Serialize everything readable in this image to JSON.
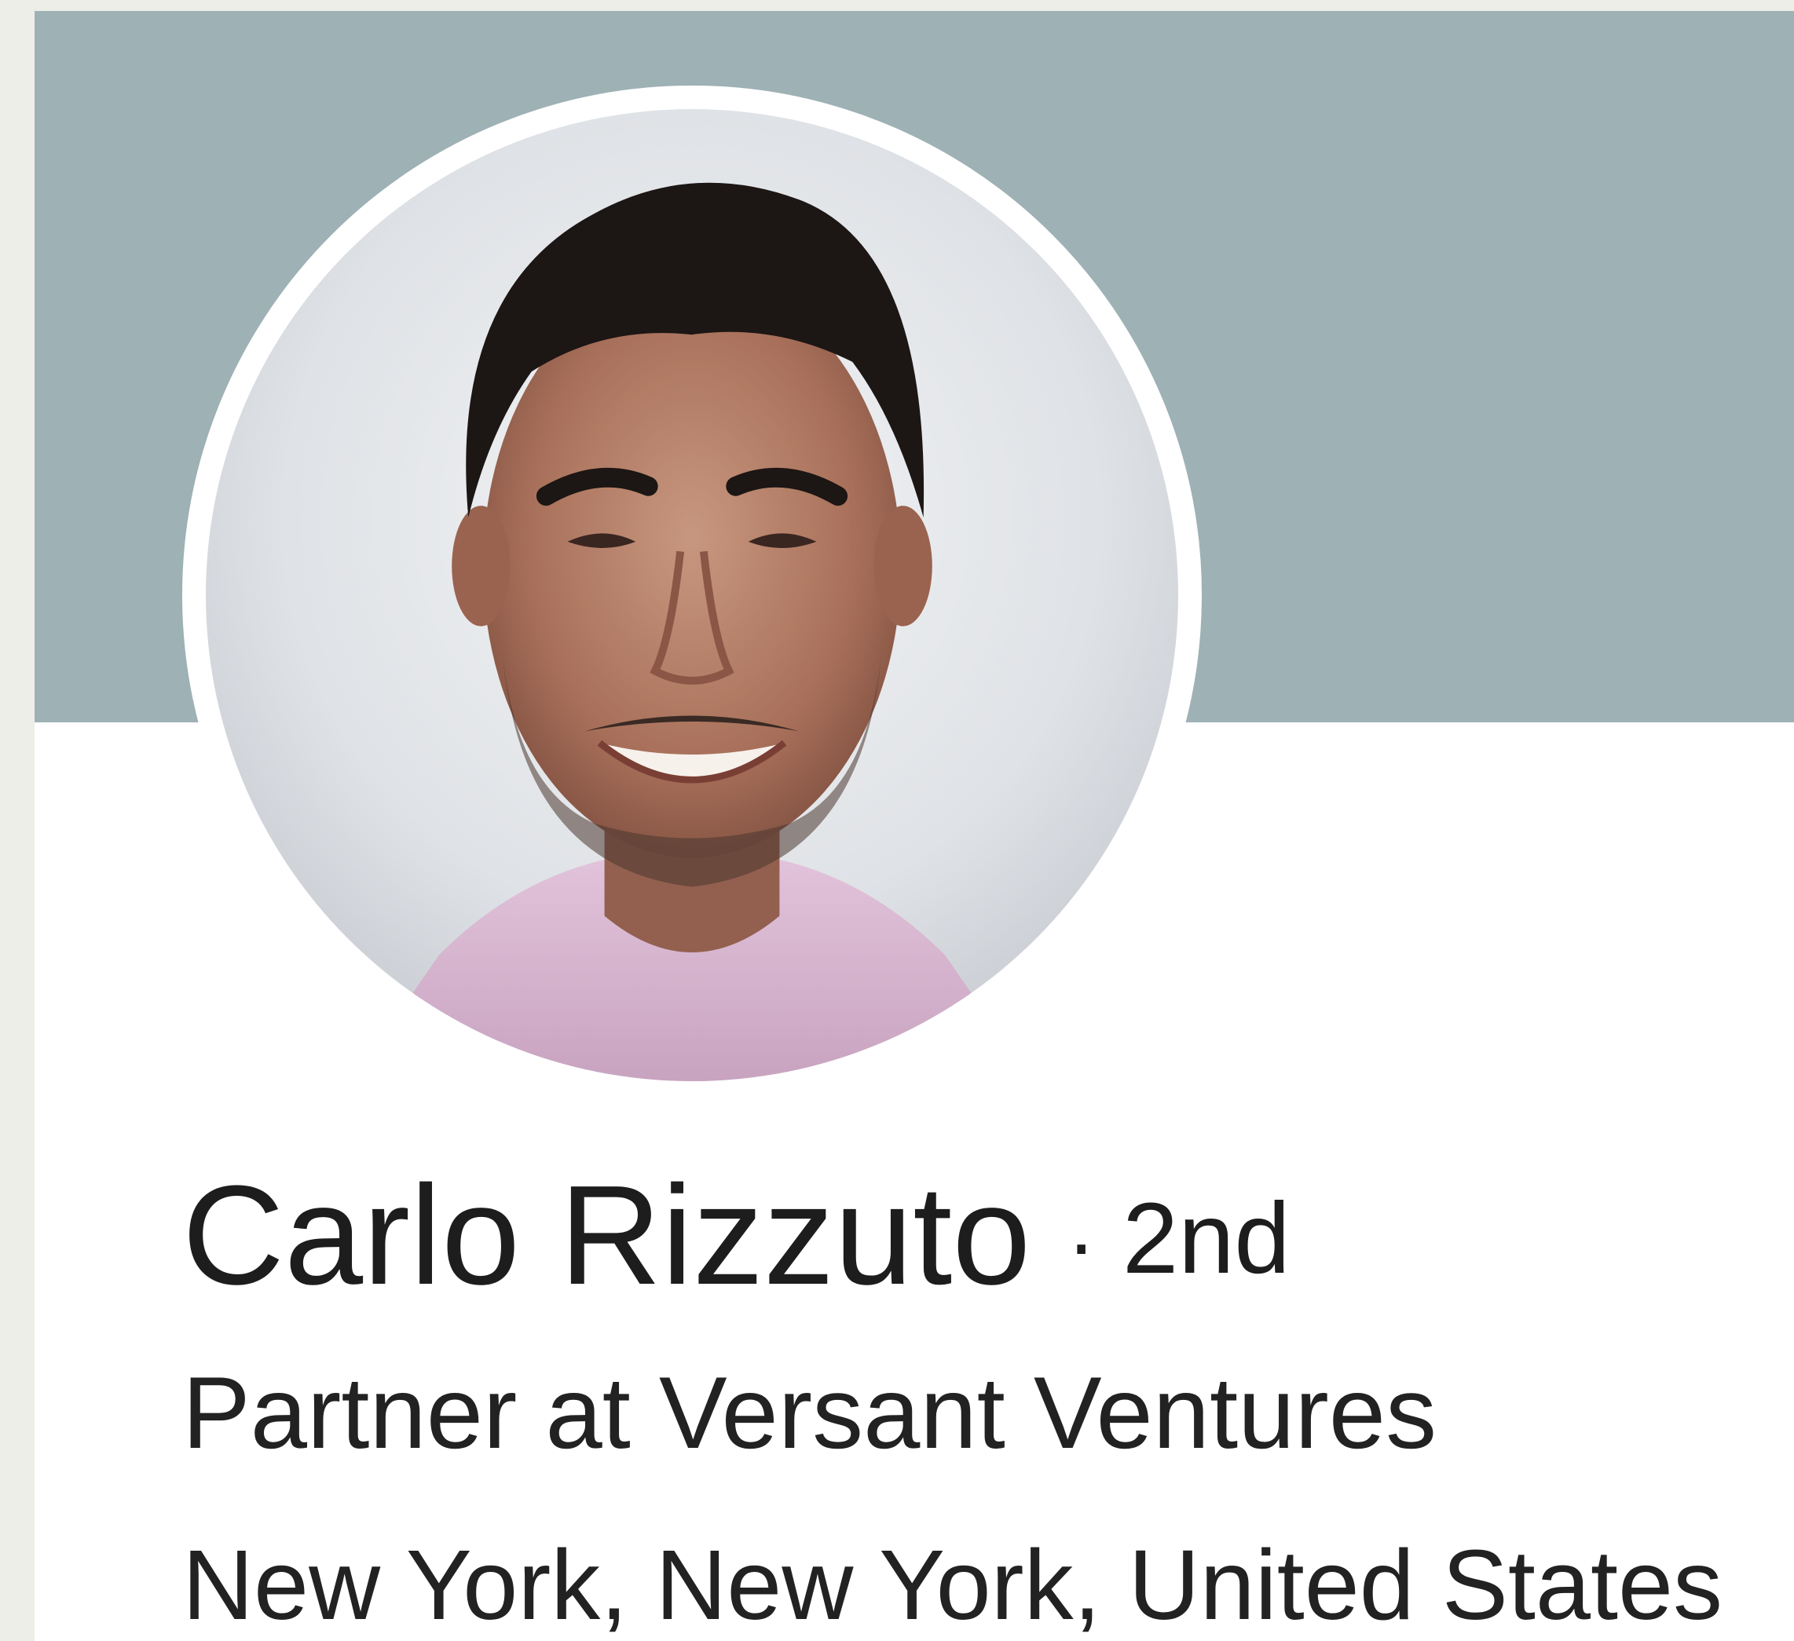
{
  "profile": {
    "name": "Carlo Rizzuto",
    "separator": "·",
    "connection_degree": "2nd",
    "headline": "Partner at Versant Ventures",
    "location": "New York, New York, United States"
  },
  "colors": {
    "banner": "#9eb1b5",
    "card_background": "#ffffff",
    "page_background": "#eeeee8",
    "text": "#1d1d1d"
  }
}
